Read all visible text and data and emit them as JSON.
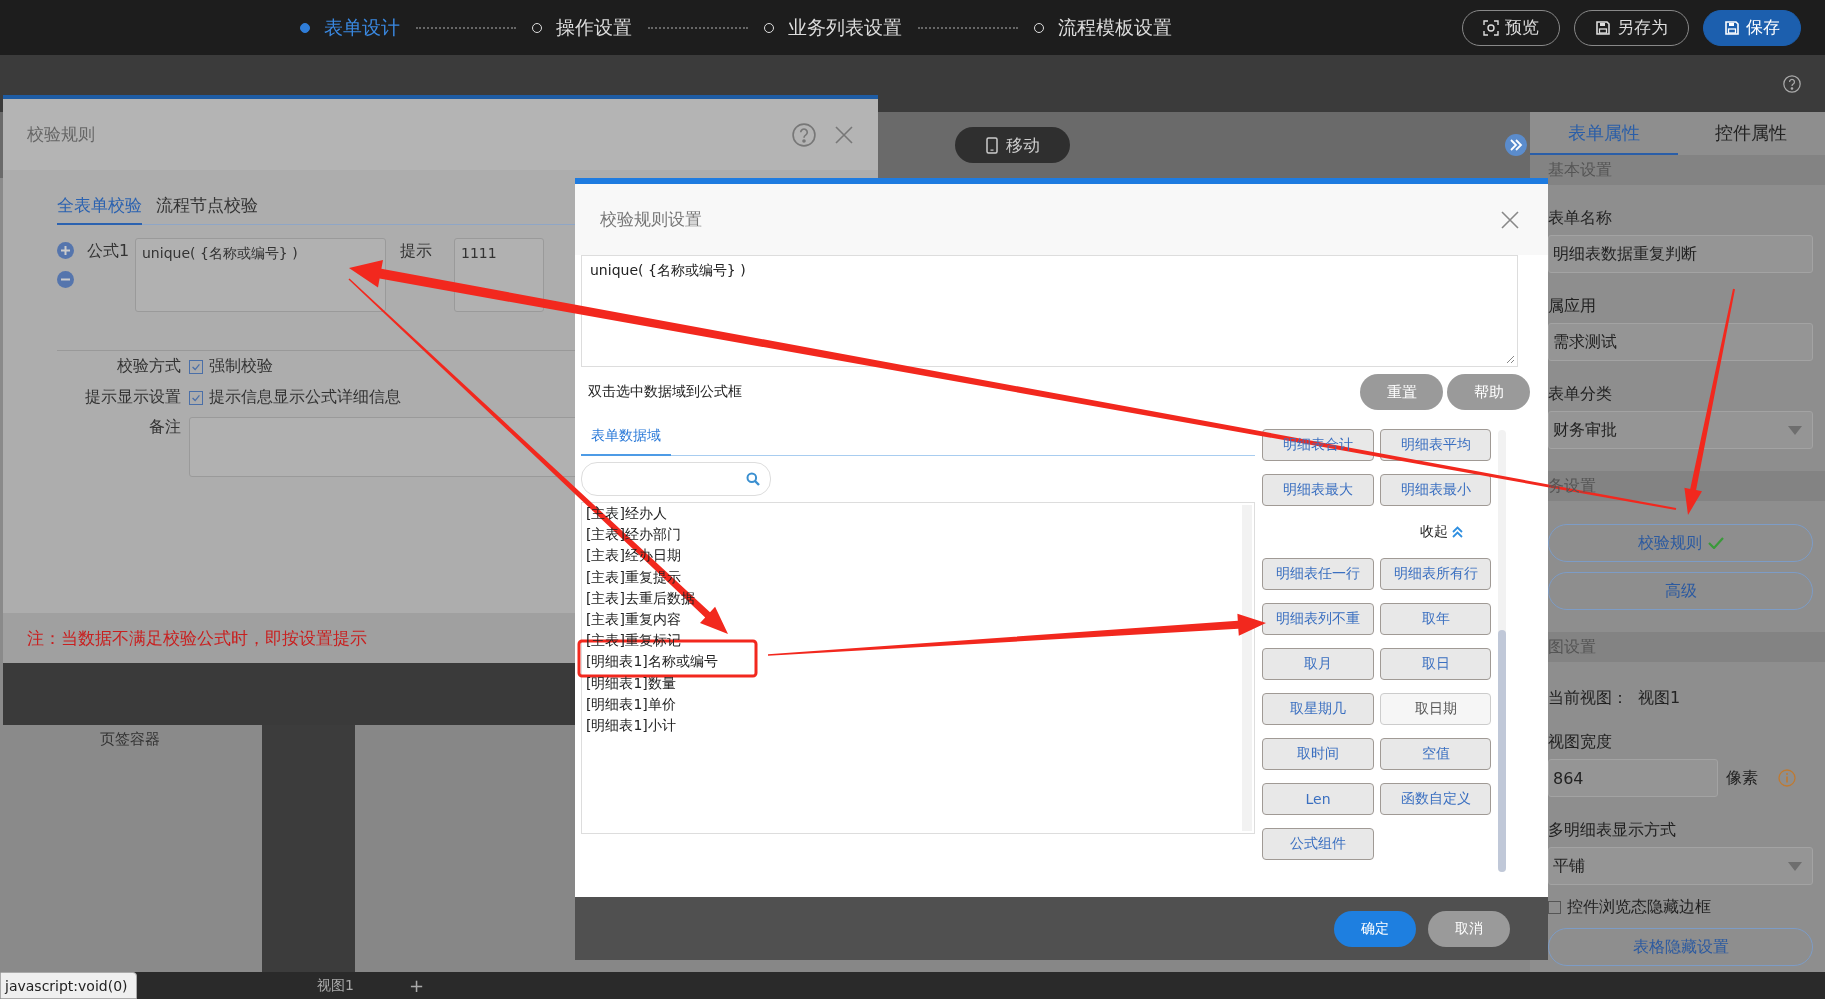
{
  "steps": [
    {
      "label": "表单设计",
      "selected": true
    },
    {
      "label": "操作设置",
      "selected": false
    },
    {
      "label": "业务列表设置",
      "selected": false
    },
    {
      "label": "流程模板设置",
      "selected": false
    }
  ],
  "top_actions": [
    {
      "label": "预览",
      "kind": "preview"
    },
    {
      "label": "另存为",
      "kind": "saveas"
    },
    {
      "label": "保存",
      "kind": "save"
    }
  ],
  "canvas": {
    "device_button": "移动",
    "hidden_label": "页签容器",
    "view_tabs": [
      "视图1"
    ],
    "add_tab": "+"
  },
  "status_tooltip": "javascript:void(0)",
  "right_panel": {
    "tabs": [
      {
        "label": "表单属性",
        "selected": true
      },
      {
        "label": "控件属性",
        "selected": false
      }
    ],
    "items": [
      {
        "kind": "section",
        "text": "基本设置"
      },
      {
        "kind": "label",
        "text": "表单名称"
      },
      {
        "kind": "field",
        "value": "明细表数据重复判断"
      },
      {
        "kind": "label",
        "text": "属应用"
      },
      {
        "kind": "field",
        "value": "需求测试"
      },
      {
        "kind": "label",
        "text": "表单分类"
      },
      {
        "kind": "select",
        "value": "财务审批"
      },
      {
        "kind": "section",
        "text": "务设置"
      },
      {
        "kind": "button",
        "text": "校验规则",
        "checked": true
      },
      {
        "kind": "button",
        "text": "高级",
        "checked": false
      },
      {
        "kind": "section",
        "text": "图设置"
      },
      {
        "kind": "pair",
        "label": "当前视图：",
        "value": "视图1"
      },
      {
        "kind": "label",
        "text": "视图宽度"
      },
      {
        "kind": "field_unit",
        "value": "864",
        "unit": "像素"
      },
      {
        "kind": "label",
        "text": "多明细表显示方式"
      },
      {
        "kind": "select",
        "value": "平铺"
      },
      {
        "kind": "checkbox",
        "text": "控件浏览态隐藏边框",
        "checked": false
      },
      {
        "kind": "button",
        "text": "表格隐藏设置",
        "checked": false
      }
    ]
  },
  "validation_dialog": {
    "title": "校验规则",
    "tabs": [
      {
        "label": "全表单校验",
        "selected": true
      },
      {
        "label": "流程节点校验",
        "selected": false
      }
    ],
    "formula_label": "公式1",
    "formula": "unique( {名称或编号} )",
    "tip_label": "提示",
    "tip_value": "1111",
    "options": [
      {
        "label": "校验方式",
        "text": "强制校验",
        "checked": true
      },
      {
        "label": "提示显示设置",
        "text": "提示信息显示公式详细信息",
        "checked": true
      }
    ],
    "remark_label": "备注",
    "note": "注：当数据不满足校验公式时，即按设置提示"
  },
  "rule_dialog": {
    "title": "校验规则设置",
    "formula": "unique( {名称或编号} )",
    "hint": "双击选中数据域到公式框",
    "actions": [
      "重置",
      "帮助"
    ],
    "tab": "表单数据域",
    "fields": [
      "[主表]经办人",
      "[主表]经办部门",
      "[主表]经办日期",
      "[主表]重复提示",
      "[主表]去重后数据",
      "[主表]重复内容",
      "[主表]重复标记",
      "[明细表1]名称或编号",
      "[明细表1]数量",
      "[明细表1]单价",
      "[明细表1]小计"
    ],
    "functions_top": [
      {
        "label": "明细表合计",
        "hovered": false
      },
      {
        "label": "明细表平均",
        "hovered": false
      },
      {
        "label": "明细表最大",
        "hovered": false
      },
      {
        "label": "明细表最小",
        "hovered": false
      }
    ],
    "collapse": "收起",
    "functions": [
      {
        "label": "明细表任一行",
        "hovered": false
      },
      {
        "label": "明细表所有行",
        "hovered": false
      },
      {
        "label": "明细表列不重",
        "hovered": false
      },
      {
        "label": "取年",
        "hovered": false
      },
      {
        "label": "取月",
        "hovered": false
      },
      {
        "label": "取日",
        "hovered": false
      },
      {
        "label": "取星期几",
        "hovered": false
      },
      {
        "label": "取日期",
        "hovered": true
      },
      {
        "label": "取时间",
        "hovered": false
      },
      {
        "label": "空值",
        "hovered": false
      },
      {
        "label": "Len",
        "hovered": false
      },
      {
        "label": "函数自定义",
        "hovered": false
      },
      {
        "label": "公式组件",
        "hovered": false
      }
    ],
    "confirm": "确定",
    "cancel": "取消"
  }
}
